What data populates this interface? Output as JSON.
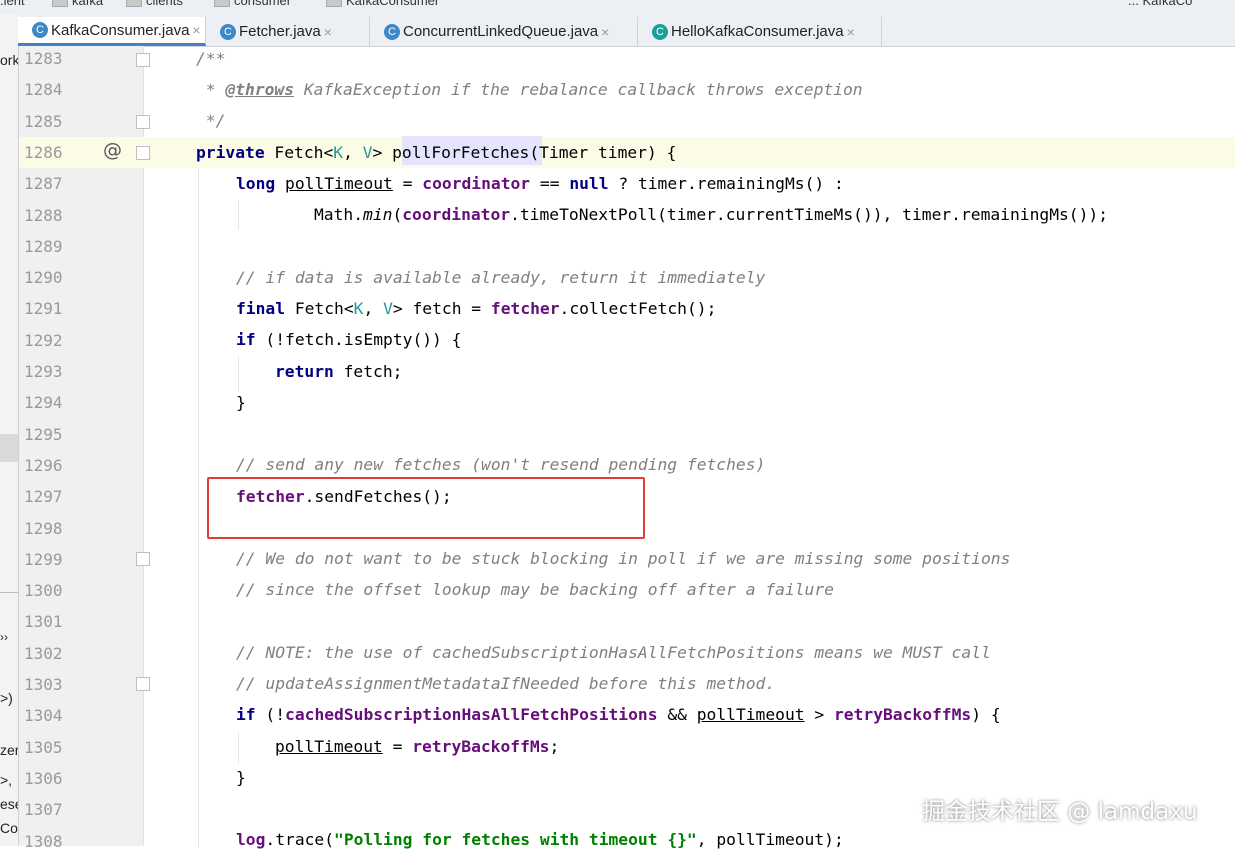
{
  "breadcrumb": [
    ".ient",
    "kafka",
    "clients",
    "consumer",
    "KafkaConsumer"
  ],
  "breadcrumb_right": "... KafkaCo",
  "tabs": [
    {
      "label": "KafkaConsumer.java",
      "active": true,
      "icon": "java-class-icon"
    },
    {
      "label": "Fetcher.java",
      "active": false,
      "icon": "java-class-icon"
    },
    {
      "label": "ConcurrentLinkedQueue.java",
      "active": false,
      "icon": "java-class-icon"
    },
    {
      "label": "HelloKafkaConsumer.java",
      "active": false,
      "icon": "java-runnable-class-icon"
    }
  ],
  "tab_close_glyph": "×",
  "left_panel_fragments": [
    "ork",
    "››",
    ">)",
    "zer",
    ">,",
    "ese",
    "Co"
  ],
  "line_numbers": [
    "1283",
    "1284",
    "1285",
    "1286",
    "1287",
    "1288",
    "1289",
    "1290",
    "1291",
    "1292",
    "1293",
    "1294",
    "1295",
    "1296",
    "1297",
    "1298",
    "1299",
    "1300",
    "1301",
    "1302",
    "1303",
    "1304",
    "1305",
    "1306",
    "1307",
    "1308"
  ],
  "gutter_marker": "@",
  "code": {
    "l1283": "/**",
    "l1284_star": " * ",
    "l1284_tag": "@throws",
    "l1284_type": " KafkaException",
    "l1284_rest": " if the rebalance callback throws exception",
    "l1285": " */",
    "l1286": [
      "private",
      " Fetch",
      "<",
      "K",
      ", ",
      "V",
      "> ",
      "pollForFetches",
      "(Timer timer) {"
    ],
    "l1287": [
      "long",
      " ",
      "pollTimeout",
      " = ",
      "coordinator",
      " == ",
      "null",
      " ? timer.remainingMs() :"
    ],
    "l1288": [
      "Math.",
      "min",
      "(",
      "coordinator",
      ".timeToNextPoll(timer.currentTimeMs()), timer.remainingMs());"
    ],
    "l1290": "// if data is available already, return it immediately",
    "l1291": [
      "final",
      " Fetch",
      "<",
      "K",
      ", ",
      "V",
      "> fetch = ",
      "fetcher",
      ".collectFetch();"
    ],
    "l1292": [
      "if",
      " (!fetch.isEmpty()) {"
    ],
    "l1293": [
      "return",
      " fetch;"
    ],
    "l1294": "}",
    "l1296": "// send any new fetches (won't resend pending fetches)",
    "l1297": [
      "fetcher",
      ".sendFetches();"
    ],
    "l1299": "// We do not want to be stuck blocking in poll if we are missing some positions",
    "l1300": "// since the offset lookup may be backing off after a failure",
    "l1302": "// NOTE: the use of cachedSubscriptionHasAllFetchPositions means we MUST call",
    "l1303": "// updateAssignmentMetadataIfNeeded before this method.",
    "l1304": [
      "if",
      " (!",
      "cachedSubscriptionHasAllFetchPositions",
      " && ",
      "pollTimeout",
      " > ",
      "retryBackoffMs",
      ") {"
    ],
    "l1305": [
      "pollTimeout",
      " = ",
      "retryBackoffMs",
      ";"
    ],
    "l1306": "}",
    "l1308": [
      "log",
      ".trace(",
      "\"Polling for fetches with timeout {}\"",
      ", pollTimeout);"
    ]
  },
  "watermark": "掘金技术社区 @ lamdaxu",
  "colors": {
    "keyword": "#000080",
    "comment": "#808080",
    "field": "#660e7a",
    "type_param": "#20999d",
    "string": "#008000",
    "highlight_box": "#e33a3a",
    "current_line": "#fcfbe6"
  }
}
